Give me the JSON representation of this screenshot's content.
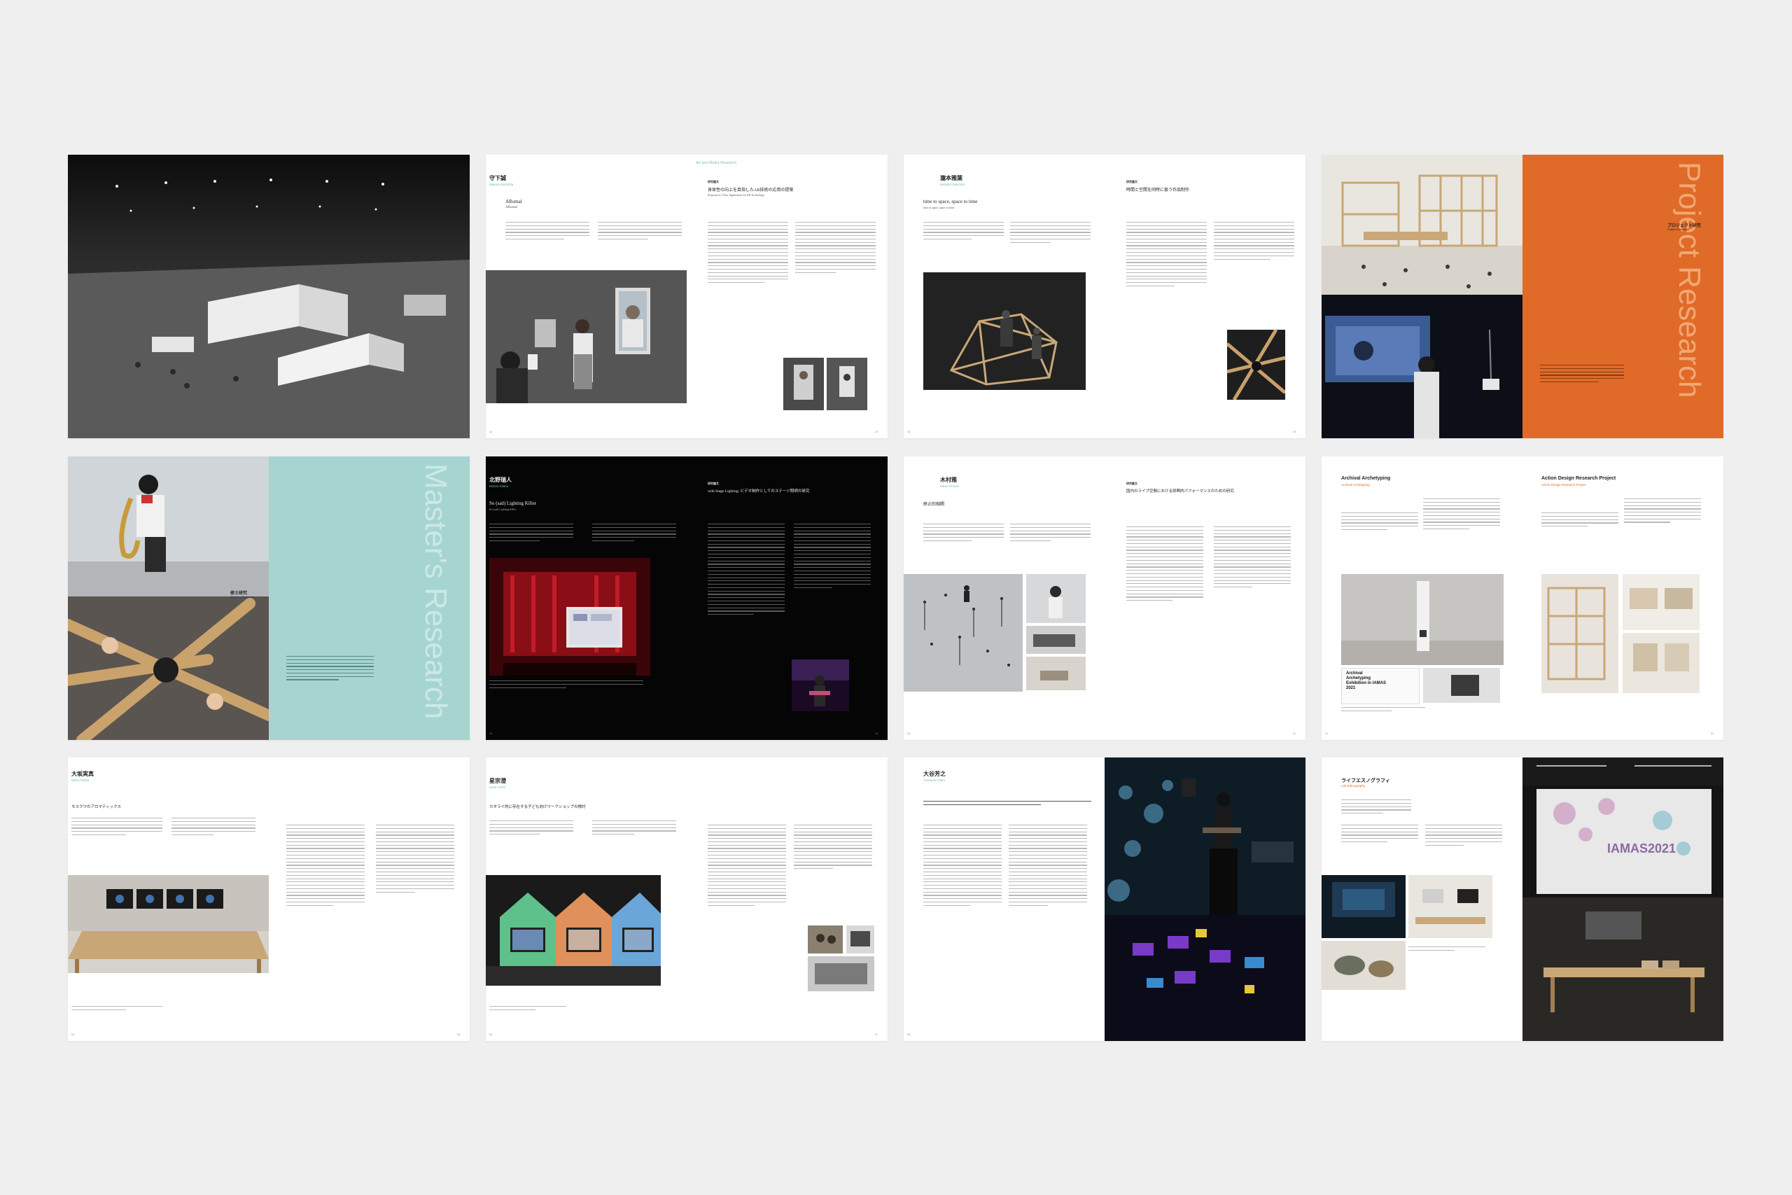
{
  "spreads": {
    "s2": {
      "header": "Art and Media Research",
      "name": "守下誠",
      "name_en": "Makoto Morishita",
      "work_en": "ARumal",
      "work_en_sub": "ARumal",
      "sect": "研究論文",
      "title_ja": "身体性の向上を目指したAR技術の応用の提案",
      "title_en": "Proposal of a New Application for AR Technology"
    },
    "s3": {
      "name": "瀧本雅葉",
      "name_en": "Masaha Takimoto",
      "work_en": "time to space, space to time",
      "work_en_sub": "time to space, space to time",
      "sect": "研究論文",
      "title_ja": "時間と空間を同時に扱う作品制作"
    },
    "s4": {
      "label_ja": "プロジェクト研究",
      "label_en": "Project Research",
      "vertical": "Project Research"
    },
    "s5": {
      "label_ja": "修士研究",
      "label_en": "Master's Research",
      "vertical": "Master's Research"
    },
    "s6": {
      "name": "北野瑞人",
      "name_en": "Mizuto Kitano",
      "work_en": "So (sad) Lighting Killer",
      "work_en_sub": "So (sad) Lighting Killer",
      "sect": "研究論文",
      "title_ja": "with Stage Lighting: ビデオ制作としてのステージ照明の研究"
    },
    "s7": {
      "name": "木村雅",
      "name_en": "Masa Kimura",
      "work_ja": "終止的相関",
      "sect": "研究論文",
      "title_ja": "国内のライブ空間における即興的パフォーマンスのための研究"
    },
    "s8": {
      "left_title": "Archival Archetyping",
      "left_sub": "Archival Archetyping",
      "right_title": "Action Design Research Project",
      "right_sub": "Action Design Research Project",
      "poster_text": "Archival Archetyping Exhibition in IAMAS 2021"
    },
    "s9": {
      "name": "大坂実真",
      "name_en": "Mima Osaka",
      "work_ja": "モスクワのアロマティックス"
    },
    "s10": {
      "name": "星宗澄",
      "name_en": "Sumi Hoshi",
      "work_ja": "カタライ的に存在する子ども向けワークショップの検討"
    },
    "s11": {
      "name": "大谷芳之",
      "name_en": "Yoshiyuki Otani"
    },
    "s12": {
      "name": "ライフエスノグラフィ",
      "name_en": "Life Ethnography",
      "banner": "IAMAS2021"
    }
  }
}
